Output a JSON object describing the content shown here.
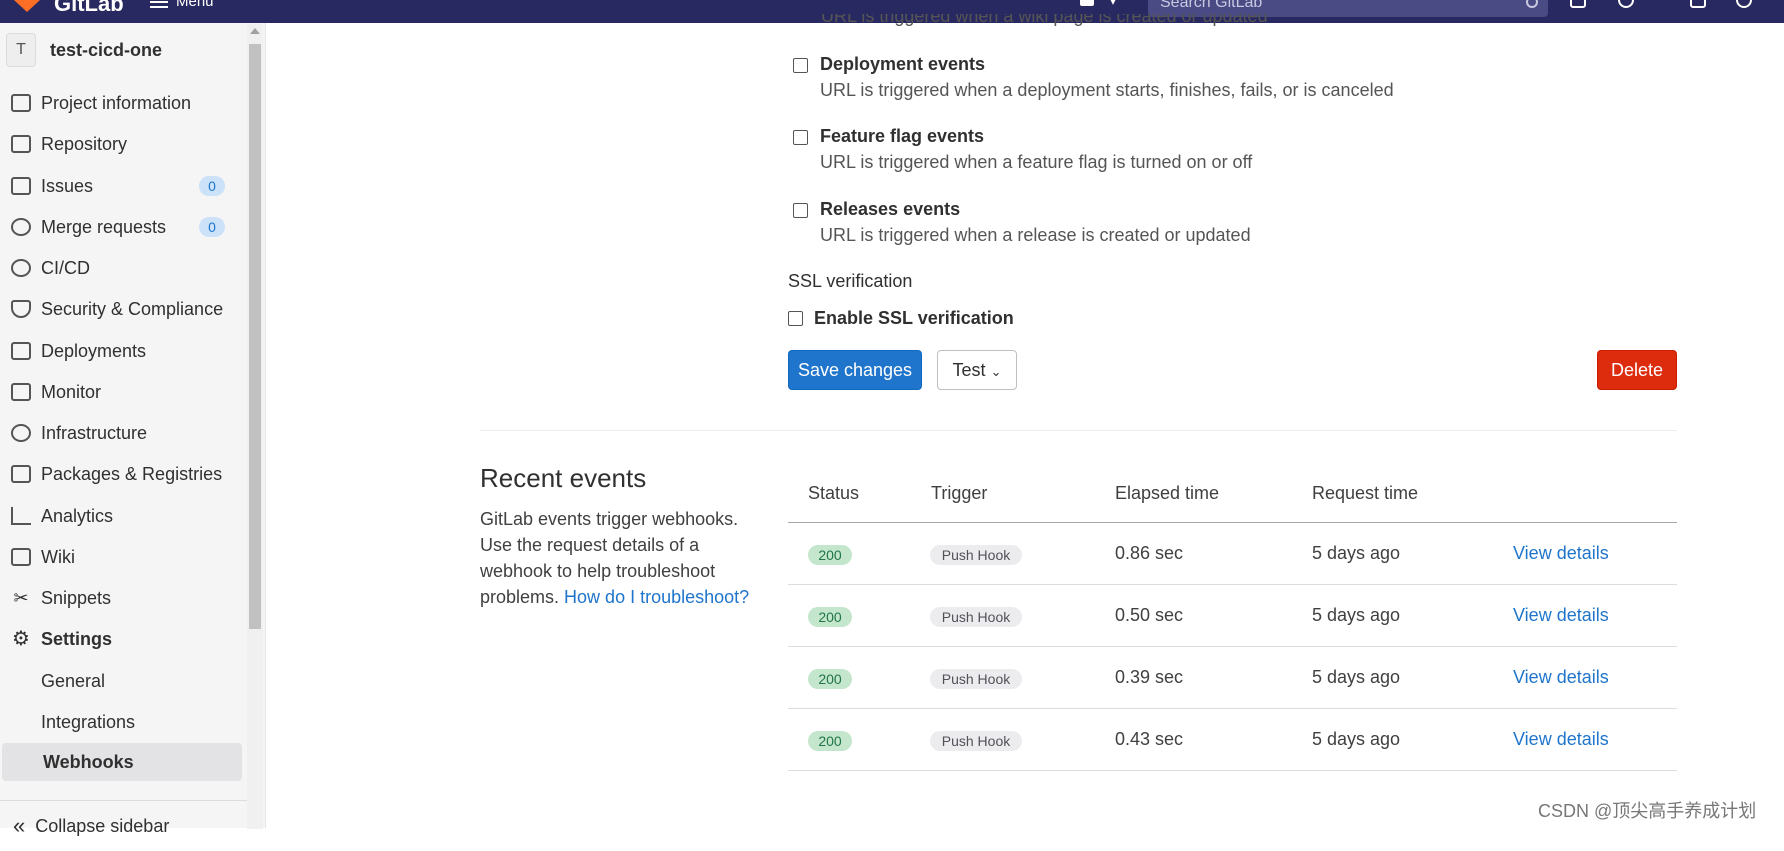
{
  "topbar": {
    "brand": "GitLab",
    "menu_label": "Menu",
    "search_placeholder": "Search GitLab"
  },
  "sidebar": {
    "project_initial": "T",
    "project_name": "test-cicd-one",
    "items": [
      {
        "label": "Project information",
        "icon": "project-information-icon"
      },
      {
        "label": "Repository",
        "icon": "repository-icon"
      },
      {
        "label": "Issues",
        "icon": "issues-icon",
        "count": "0"
      },
      {
        "label": "Merge requests",
        "icon": "merge-requests-icon",
        "count": "0"
      },
      {
        "label": "CI/CD",
        "icon": "rocket-icon"
      },
      {
        "label": "Security & Compliance",
        "icon": "shield-icon"
      },
      {
        "label": "Deployments",
        "icon": "deployments-icon"
      },
      {
        "label": "Monitor",
        "icon": "monitor-icon"
      },
      {
        "label": "Infrastructure",
        "icon": "infrastructure-icon"
      },
      {
        "label": "Packages & Registries",
        "icon": "package-icon"
      },
      {
        "label": "Analytics",
        "icon": "analytics-icon"
      },
      {
        "label": "Wiki",
        "icon": "book-icon"
      },
      {
        "label": "Snippets",
        "icon": "scissors-icon"
      },
      {
        "label": "Settings",
        "icon": "gear-icon"
      }
    ],
    "settings_sub": [
      {
        "label": "General"
      },
      {
        "label": "Integrations"
      },
      {
        "label": "Webhooks"
      }
    ],
    "collapse_label": "Collapse sidebar"
  },
  "triggers": {
    "partial_desc": "URL is triggered when a wiki page is created or updated",
    "items": [
      {
        "title": "Deployment events",
        "desc": "URL is triggered when a deployment starts, finishes, fails, or is canceled"
      },
      {
        "title": "Feature flag events",
        "desc": "URL is triggered when a feature flag is turned on or off"
      },
      {
        "title": "Releases events",
        "desc": "URL is triggered when a release is created or updated"
      }
    ]
  },
  "ssl": {
    "title": "SSL verification",
    "checkbox_label": "Enable SSL verification"
  },
  "actions": {
    "save_label": "Save changes",
    "test_label": "Test",
    "delete_label": "Delete"
  },
  "recent": {
    "title": "Recent events",
    "desc": "GitLab events trigger webhooks. Use the request details of a webhook to help troubleshoot problems.",
    "help_link": "How do I troubleshoot?",
    "columns": [
      "Status",
      "Trigger",
      "Elapsed time",
      "Request time"
    ],
    "rows": [
      {
        "status": "200",
        "trigger": "Push Hook",
        "elapsed": "0.86 sec",
        "request": "5 days ago",
        "link": "View details"
      },
      {
        "status": "200",
        "trigger": "Push Hook",
        "elapsed": "0.50 sec",
        "request": "5 days ago",
        "link": "View details"
      },
      {
        "status": "200",
        "trigger": "Push Hook",
        "elapsed": "0.39 sec",
        "request": "5 days ago",
        "link": "View details"
      },
      {
        "status": "200",
        "trigger": "Push Hook",
        "elapsed": "0.43 sec",
        "request": "5 days ago",
        "link": "View details"
      }
    ]
  },
  "watermark": "CSDN @顶尖高手养成计划",
  "colors": {
    "topbar": "#292961",
    "primary": "#1f75cb",
    "danger": "#dd2b0e",
    "success_badge": "#c3e6cd"
  }
}
